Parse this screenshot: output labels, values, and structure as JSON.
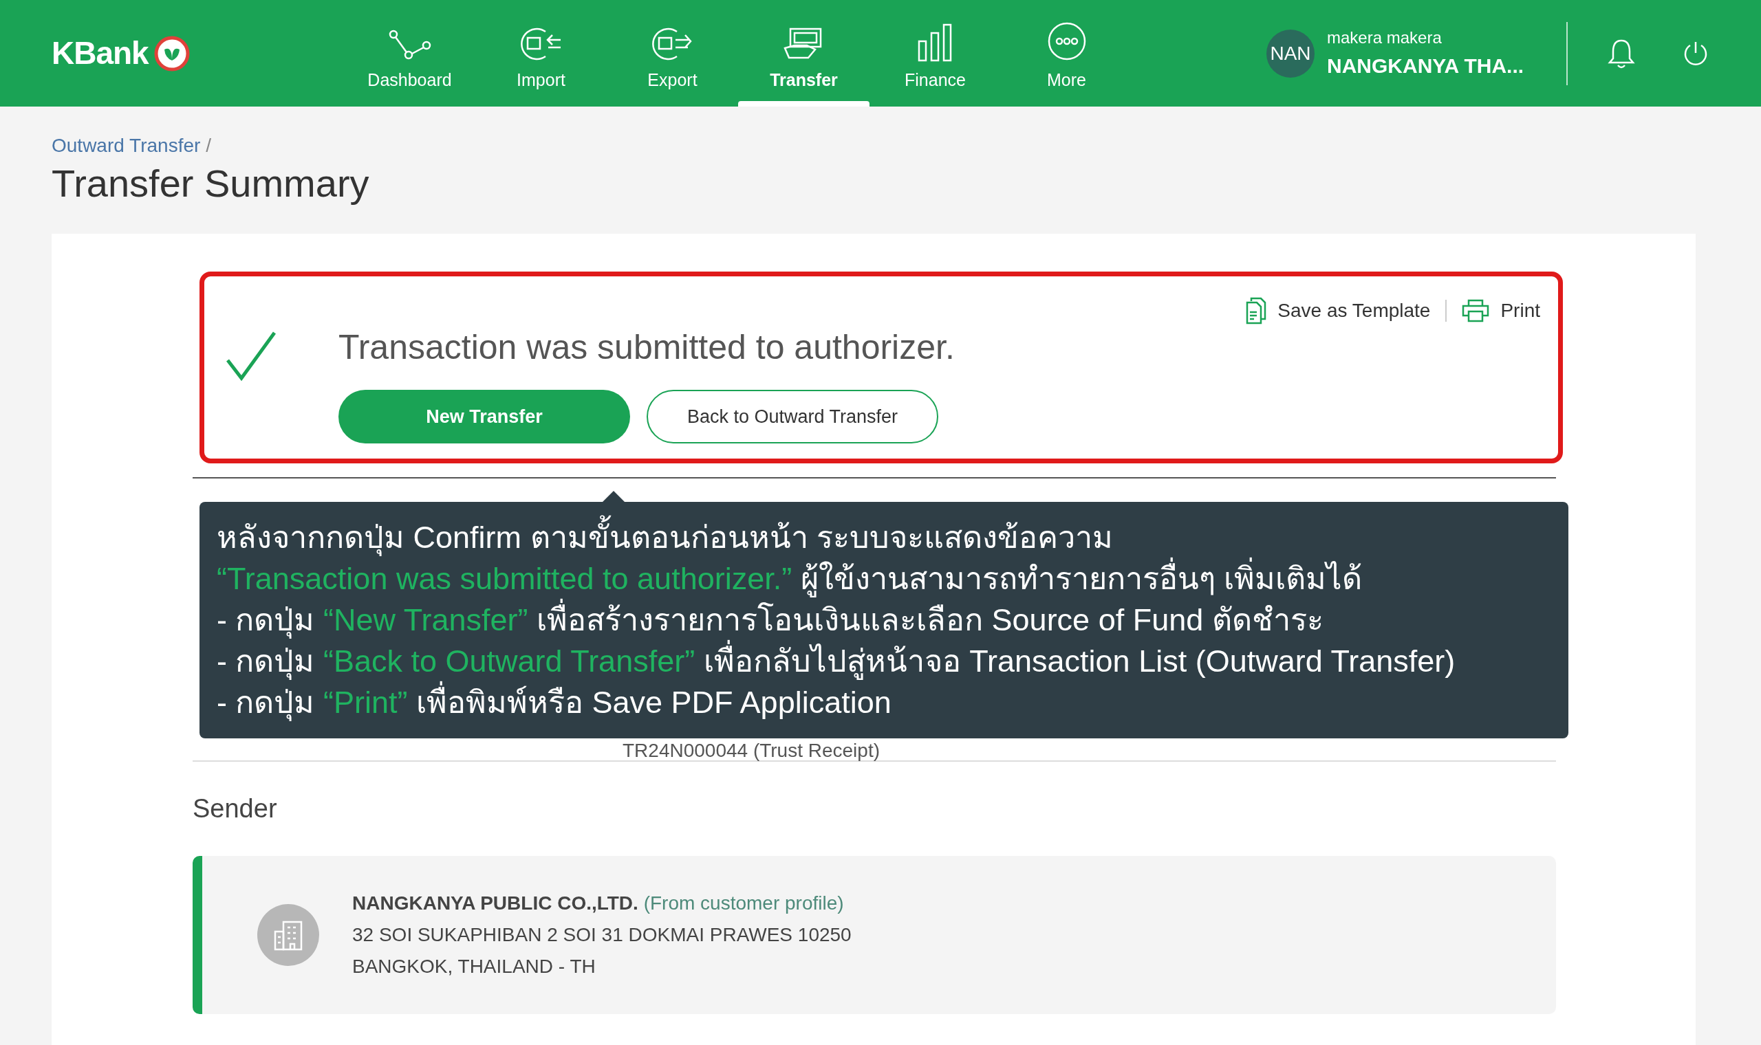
{
  "header": {
    "logo": "KBank",
    "nav": [
      {
        "label": "Dashboard",
        "selected": false
      },
      {
        "label": "Import",
        "selected": false
      },
      {
        "label": "Export",
        "selected": false
      },
      {
        "label": "Transfer",
        "selected": true
      },
      {
        "label": "Finance",
        "selected": false
      },
      {
        "label": "More",
        "selected": false
      }
    ],
    "user": {
      "initials": "NAN",
      "role": "makera makera",
      "name": "NANGKANYA THA..."
    }
  },
  "breadcrumb": [
    "Outward Transfer"
  ],
  "breadcrumb_separator": "/",
  "page_title": "Transfer Summary",
  "result": {
    "message": "Transaction was submitted to authorizer.",
    "actions": [
      "Save as Template",
      "Print"
    ],
    "primary_button": "New Transfer",
    "secondary_button": "Back to Outward Transfer"
  },
  "tooltip": {
    "lines": [
      [
        {
          "text": "หลังจากกดปุ่ม Confirm ตามขั้นตอนก่อนหน้า ระบบจะแสดงข้อความ",
          "highlight": false
        }
      ],
      [
        {
          "text": "“Transaction was submitted to authorizer.”",
          "highlight": true
        },
        {
          "text": " ผู้ใข้งานสามารถทำรายการอื่นๆ เพิ่มเติมได้",
          "highlight": false
        }
      ],
      [
        {
          "text": "- กดปุ่ม ",
          "highlight": false
        },
        {
          "text": "“New Transfer”",
          "highlight": true
        },
        {
          "text": " เพื่อสร้างรายการโอนเงินและเลือก Source of Fund ตัดชำระ",
          "highlight": false
        }
      ],
      [
        {
          "text": "- กดปุ่ม ",
          "highlight": false
        },
        {
          "text": "“Back to Outward Transfer”",
          "highlight": true
        },
        {
          "text": " เพื่อกลับไปสู่หน้าจอ Transaction List (Outward Transfer)",
          "highlight": false
        }
      ],
      [
        {
          "text": "- กดปุ่ม ",
          "highlight": false
        },
        {
          "text": "“Print”",
          "highlight": true
        },
        {
          "text": " เพื่อพิมพ์หรือ Save PDF Application",
          "highlight": false
        }
      ]
    ]
  },
  "reference": "TR24N000044 (Trust Receipt)",
  "sender": {
    "heading": "Sender",
    "company": "NANGKANYA PUBLIC CO.,LTD.",
    "source": "(From customer profile)",
    "address_lines": [
      "32 SOI SUKAPHIBAN 2 SOI 31 DOKMAI PRAWES 10250",
      "BANGKOK, THAILAND - TH"
    ]
  }
}
